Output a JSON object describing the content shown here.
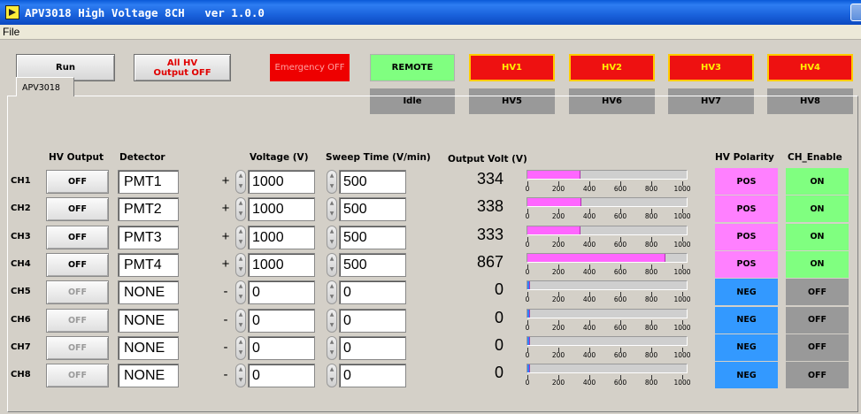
{
  "window": {
    "title": "APV3018 High Voltage 8CH   ver 1.0.0"
  },
  "menu": {
    "file": "File"
  },
  "toolbar": {
    "run_label": "Run",
    "all_hv_off_line1": "All HV",
    "all_hv_off_line2": "Output OFF",
    "emergency_label": "Emergency OFF",
    "remote_label": "REMOTE",
    "idle_label": "Idle"
  },
  "hv_indicators": [
    {
      "label": "HV1",
      "state": "on"
    },
    {
      "label": "HV2",
      "state": "on"
    },
    {
      "label": "HV3",
      "state": "on"
    },
    {
      "label": "HV4",
      "state": "on"
    },
    {
      "label": "HV5",
      "state": "off"
    },
    {
      "label": "HV6",
      "state": "off"
    },
    {
      "label": "HV7",
      "state": "off"
    },
    {
      "label": "HV8",
      "state": "off"
    }
  ],
  "tab": {
    "label": "APV3018"
  },
  "headers": {
    "hv_output": "HV Output",
    "detector": "Detector",
    "voltage": "Voltage (V)",
    "sweep_time": "Sweep Time (V/min)",
    "output_volt": "Output Volt (V)",
    "hv_polarity": "HV Polarity",
    "ch_enable": "CH_Enable"
  },
  "gauge_scale": {
    "max": 1000,
    "labels": [
      "0",
      "200",
      "400",
      "600",
      "800",
      "1000"
    ]
  },
  "colors": {
    "pos": "#ff80ff",
    "neg": "#3399ff",
    "on": "#80ff80",
    "off": "#999999",
    "hv_on_bg": "#ee1111",
    "hv_on_text": "#ffee00",
    "remote_bg": "#80ff80",
    "emergency_bg": "#ee0000"
  },
  "channels": [
    {
      "ch": "CH1",
      "output": "OFF",
      "enabled": true,
      "detector": "PMT1",
      "sign": "+",
      "voltage": "1000",
      "sweep": "500",
      "out_volt": "334",
      "out_value": 334,
      "polarity": "POS",
      "ch_enable": "ON"
    },
    {
      "ch": "CH2",
      "output": "OFF",
      "enabled": true,
      "detector": "PMT2",
      "sign": "+",
      "voltage": "1000",
      "sweep": "500",
      "out_volt": "338",
      "out_value": 338,
      "polarity": "POS",
      "ch_enable": "ON"
    },
    {
      "ch": "CH3",
      "output": "OFF",
      "enabled": true,
      "detector": "PMT3",
      "sign": "+",
      "voltage": "1000",
      "sweep": "500",
      "out_volt": "333",
      "out_value": 333,
      "polarity": "POS",
      "ch_enable": "ON"
    },
    {
      "ch": "CH4",
      "output": "OFF",
      "enabled": true,
      "detector": "PMT4",
      "sign": "+",
      "voltage": "1000",
      "sweep": "500",
      "out_volt": "867",
      "out_value": 867,
      "polarity": "POS",
      "ch_enable": "ON"
    },
    {
      "ch": "CH5",
      "output": "OFF",
      "enabled": false,
      "detector": "NONE",
      "sign": "-",
      "voltage": "0",
      "sweep": "0",
      "out_volt": "0",
      "out_value": 0,
      "polarity": "NEG",
      "ch_enable": "OFF"
    },
    {
      "ch": "CH6",
      "output": "OFF",
      "enabled": false,
      "detector": "NONE",
      "sign": "-",
      "voltage": "0",
      "sweep": "0",
      "out_volt": "0",
      "out_value": 0,
      "polarity": "NEG",
      "ch_enable": "OFF"
    },
    {
      "ch": "CH7",
      "output": "OFF",
      "enabled": false,
      "detector": "NONE",
      "sign": "-",
      "voltage": "0",
      "sweep": "0",
      "out_volt": "0",
      "out_value": 0,
      "polarity": "NEG",
      "ch_enable": "OFF"
    },
    {
      "ch": "CH8",
      "output": "OFF",
      "enabled": false,
      "detector": "NONE",
      "sign": "-",
      "voltage": "0",
      "sweep": "0",
      "out_volt": "0",
      "out_value": 0,
      "polarity": "NEG",
      "ch_enable": "OFF"
    }
  ]
}
